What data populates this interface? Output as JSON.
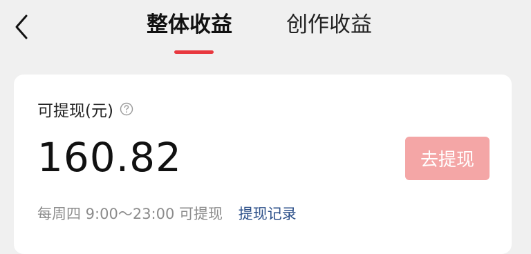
{
  "nav": {
    "back_icon": "chevron-left-icon",
    "tabs": [
      {
        "label": "整体收益",
        "active": true
      },
      {
        "label": "创作收益",
        "active": false
      }
    ]
  },
  "card": {
    "label": "可提现(元)",
    "help_icon": "question-circle-icon",
    "amount": "160.82",
    "withdraw_button": "去提现",
    "schedule": "每周四 9:00～23:00 可提现",
    "records_link": "提现记录"
  },
  "colors": {
    "accent": "#e8383f",
    "button_disabled_bg": "#f4a6a6",
    "link": "#2a4e88",
    "muted_text": "#8c8c8c",
    "background": "#f0f0f0",
    "card": "#ffffff"
  }
}
